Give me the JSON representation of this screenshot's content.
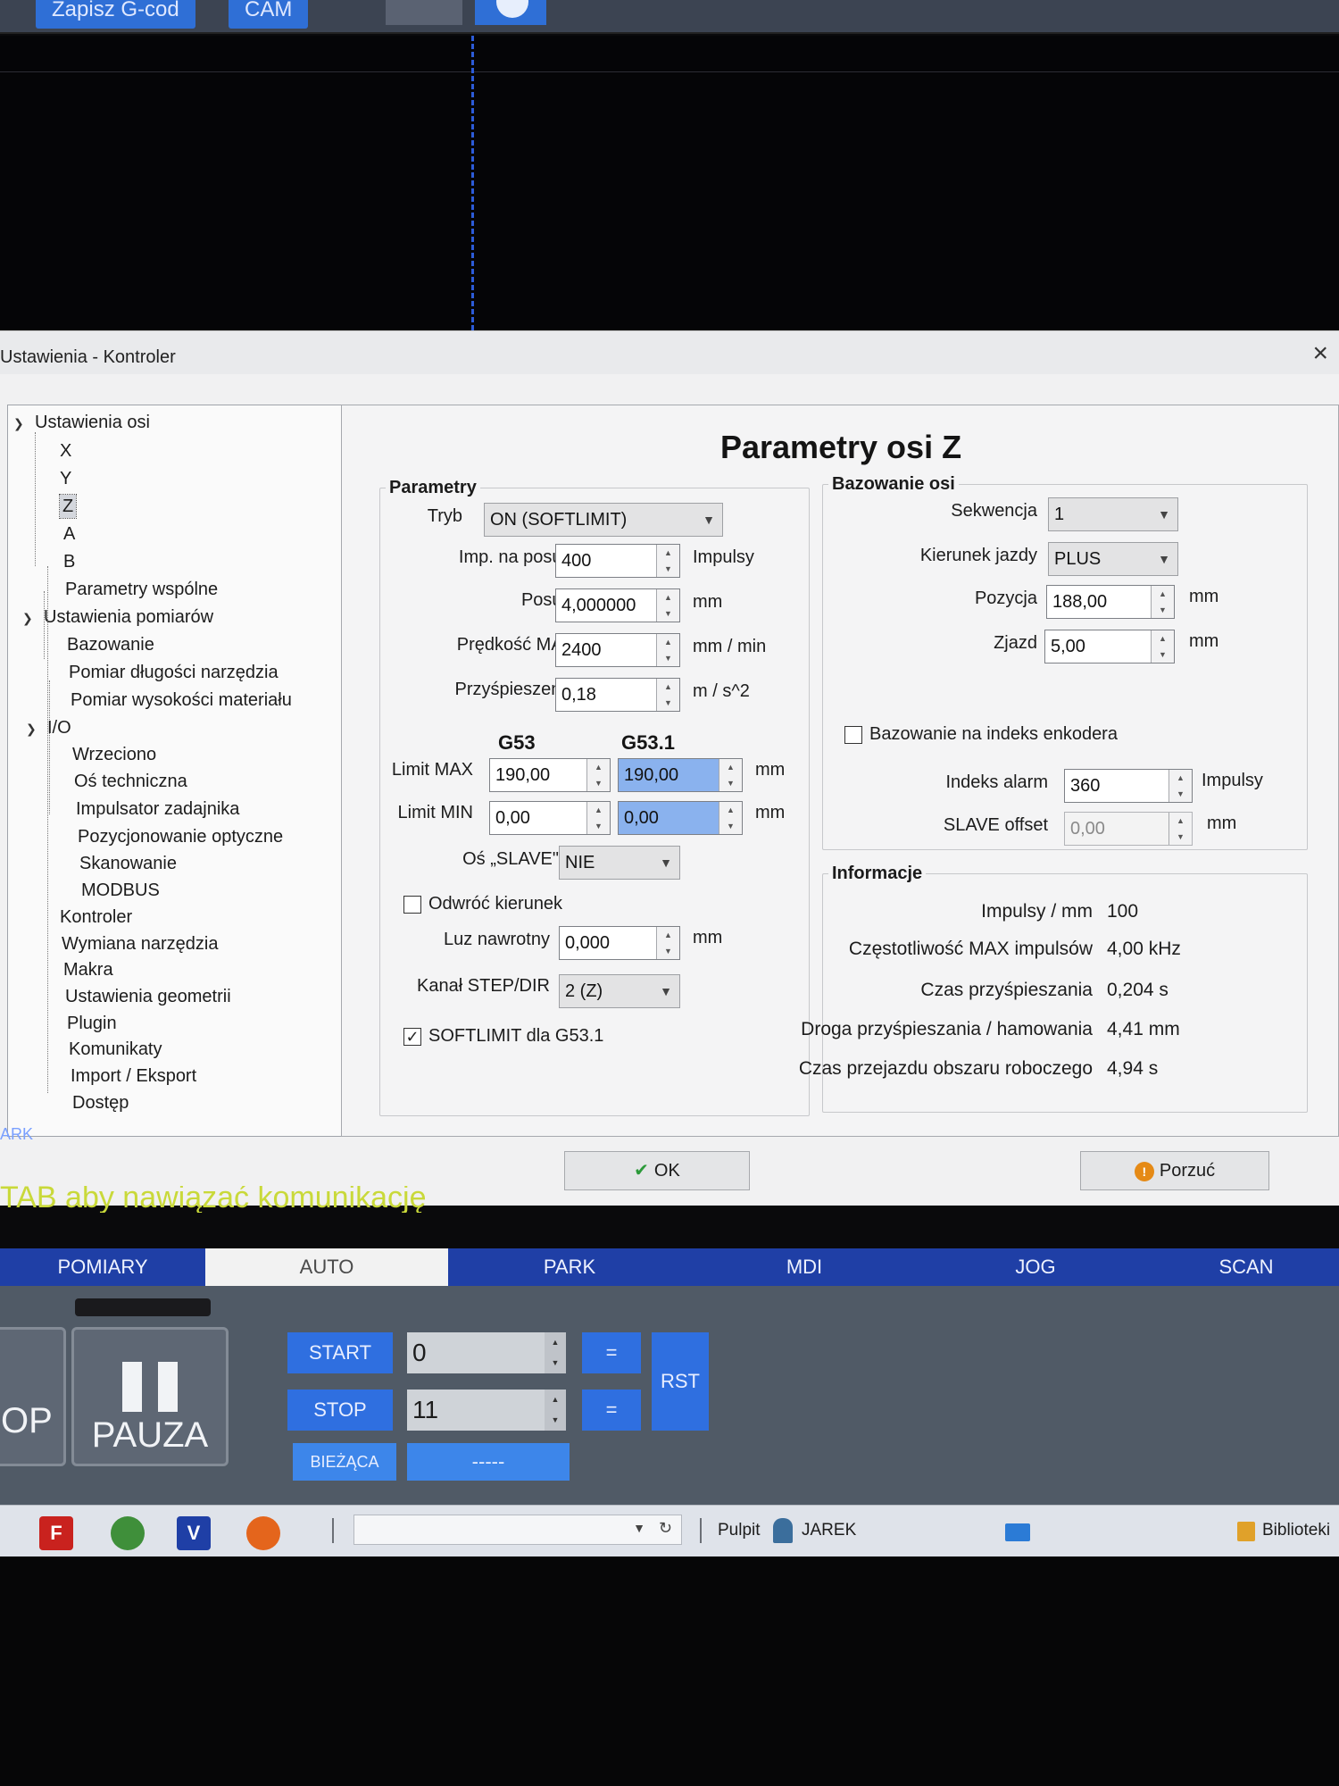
{
  "toolbar": {
    "save_gcode_label": "Zapisz G-cod",
    "cam_label": "CAM"
  },
  "dialog": {
    "title": "Ustawienia - Kontroler",
    "close_symbol": "×"
  },
  "tree": {
    "axes_settings": "Ustawienia osi",
    "axes": [
      "X",
      "Y",
      "Z",
      "A",
      "B"
    ],
    "common_params": "Parametry wspólne",
    "measurement_settings": "Ustawienia pomiarów",
    "measurement_items": [
      "Bazowanie",
      "Pomiar długości narzędzia",
      "Pomiar wysokości materiału"
    ],
    "io": "I/O",
    "io_items": [
      "Wrzeciono",
      "Oś techniczna",
      "Impulsator zadajnika",
      "Pozycjonowanie optyczne",
      "Skanowanie",
      "MODBUS"
    ],
    "other_items": [
      "Kontroler",
      "Wymiana narzędzia",
      "Makra",
      "Ustawienia geometrii",
      "Plugin",
      "Komunikaty",
      "Import / Eksport",
      "Dostęp"
    ],
    "selected": "Z"
  },
  "panel": {
    "title": "Parametry osi Z",
    "params": {
      "group_title": "Parametry",
      "mode_label": "Tryb",
      "mode_value": "ON (SOFTLIMIT)",
      "imp_label": "Imp. na posuw",
      "imp_value": "400",
      "imp_unit": "Impulsy",
      "feed_label": "Posuw",
      "feed_value": "4,000000",
      "feed_unit": "mm",
      "vmax_label": "Prędkość MAX",
      "vmax_value": "2400",
      "vmax_unit": "mm / min",
      "acc_label": "Przyśpieszenie",
      "acc_value": "0,18",
      "acc_unit": "m / s^2",
      "col_g53": "G53",
      "col_g531": "G53.1",
      "limit_max_label": "Limit MAX",
      "limit_max_g53": "190,00",
      "limit_max_g531": "190,00",
      "limit_max_unit": "mm",
      "limit_min_label": "Limit MIN",
      "limit_min_g53": "0,00",
      "limit_min_g531": "0,00",
      "limit_min_unit": "mm",
      "slave_label": "Oś „SLAVE\"",
      "slave_value": "NIE",
      "reverse_label": "Odwróć kierunek",
      "reverse_checked": false,
      "backlash_label": "Luz nawrotny",
      "backlash_value": "0,000",
      "backlash_unit": "mm",
      "channel_label": "Kanał STEP/DIR",
      "channel_value": "2 (Z)",
      "softlimit_label": "SOFTLIMIT dla G53.1",
      "softlimit_checked": true
    },
    "homing": {
      "group_title": "Bazowanie osi",
      "sequence_label": "Sekwencja",
      "sequence_value": "1",
      "direction_label": "Kierunek jazdy",
      "direction_value": "PLUS",
      "position_label": "Pozycja",
      "position_value": "188,00",
      "position_unit": "mm",
      "retract_label": "Zjazd",
      "retract_value": "5,00",
      "retract_unit": "mm",
      "encoder_index_label": "Bazowanie na indeks enkodera",
      "encoder_index_checked": false,
      "index_alarm_label": "Indeks alarm",
      "index_alarm_value": "360",
      "index_alarm_unit": "Impulsy",
      "slave_offset_label": "SLAVE offset",
      "slave_offset_value": "0,00",
      "slave_offset_unit": "mm"
    },
    "info": {
      "group_title": "Informacje",
      "rows": [
        {
          "label": "Impulsy / mm",
          "value": "100"
        },
        {
          "label": "Częstotliwość MAX impulsów",
          "value": "4,00 kHz"
        },
        {
          "label": "Czas przyśpieszania",
          "value": "0,204 s"
        },
        {
          "label": "Droga przyśpieszania / hamowania",
          "value": "4,41 mm"
        },
        {
          "label": "Czas przejazdu obszaru roboczego",
          "value": "4,94 s"
        }
      ]
    }
  },
  "buttons": {
    "ok_label": "OK",
    "cancel_label": "Porzuć"
  },
  "background": {
    "status_text": "TAB aby nawiązać komunikację",
    "left_label": "ARK"
  },
  "modes": {
    "tabs": [
      "POMIARY",
      "AUTO",
      "PARK",
      "MDI",
      "JOG",
      "SCAN"
    ],
    "active": "AUTO"
  },
  "control": {
    "stop_partial": "OP",
    "pause_label": "PAUZA",
    "start_label": "START",
    "start_value": "0",
    "stop_label": "STOP",
    "stop_value": "11",
    "current_label": "BIEŻĄCA",
    "current_value": "-----",
    "eq_symbol": "=",
    "rst_label": "RST"
  },
  "taskbar": {
    "desktop_label": "Pulpit",
    "user_label": "JAREK",
    "libraries_label": "Biblioteki"
  },
  "colors": {
    "accent_blue": "#2f6fe0",
    "mode_bar": "#1f3fa6",
    "highlight_field": "#8ab2ee",
    "status_yellow": "#c9d93a"
  }
}
